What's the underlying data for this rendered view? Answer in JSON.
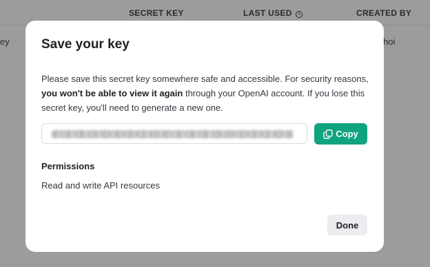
{
  "background": {
    "columns": [
      "SECRET KEY",
      "LAST USED",
      "CREATED BY"
    ],
    "row_fragments": {
      "name": "ey",
      "created_by": "hoi"
    }
  },
  "modal": {
    "title": "Save your key",
    "description": {
      "part1": "Please save this secret key somewhere safe and accessible. For security reasons, ",
      "bold": "you won't be able to view it again",
      "part2": " through your OpenAI account. If you lose this secret key, you'll need to generate a new one."
    },
    "key_field": {
      "value": "",
      "redacted": true
    },
    "copy_button": {
      "label": "Copy",
      "icon": "copy-icon"
    },
    "permissions": {
      "heading": "Permissions",
      "value": "Read and write API resources"
    },
    "done_button": {
      "label": "Done"
    }
  },
  "colors": {
    "accent": "#10a37f",
    "overlay": "#9c9c9c",
    "done_bg": "#ececf1"
  }
}
